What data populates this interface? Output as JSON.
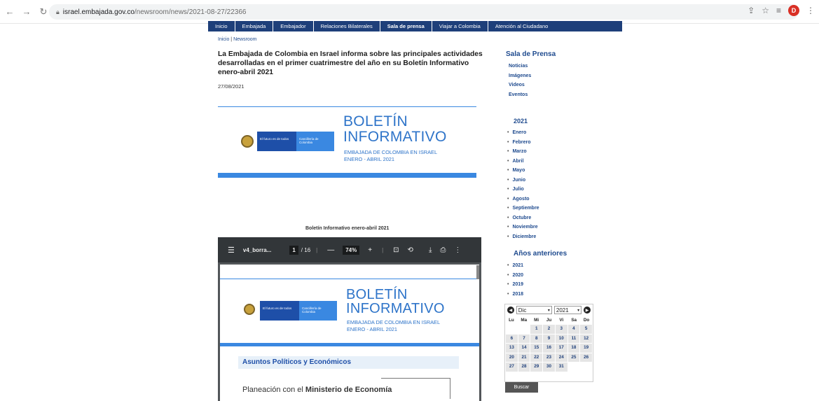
{
  "browser": {
    "url_host": "israel.embajada.gov.co",
    "url_path": "/newsroom/news/2021-08-27/22366",
    "avatar_letter": "D"
  },
  "nav": {
    "items": [
      "Inicio",
      "Embajada",
      "Embajador",
      "Relaciones Bilaterales",
      "Sala de prensa",
      "Viajar a Colombia",
      "Atención al Ciudadano"
    ],
    "active": "Sala de prensa"
  },
  "breadcrumb": {
    "home": "Inicio",
    "sep": " | ",
    "current": "Newsroom"
  },
  "article": {
    "title": "La Embajada de Colombia en Israel informa sobre las principales actividades desarrolladas en el primer cuatrimestre del año en su Boletín Informativo enero-abril 2021",
    "date": "27/08/2021",
    "pdf_caption": "Boletín Informativo enero-abril 2021"
  },
  "banner": {
    "logo_left": "El futuro es de todos",
    "logo_right": "Cancillería de Colombia",
    "title_line1": "BOLETÍN",
    "title_line2": "INFORMATIVO",
    "subtitle_line1": "EMBAJADA DE COLOMBIA EN ISRAEL",
    "subtitle_line2": "ENERO - ABRIL 2021"
  },
  "pdf": {
    "filename": "v4_borra...",
    "page_current": "1",
    "page_total": "/ 16",
    "zoom": "74%",
    "section_title": "Asuntos Políticos y Económicos",
    "subheading_prefix": "Planeación con el ",
    "subheading_bold": "Ministerio de Economía"
  },
  "sidebar": {
    "title": "Sala de Prensa",
    "links": [
      "Noticias",
      "Imágenes",
      "Videos",
      "Eventos"
    ],
    "year_title": "2021",
    "months": [
      "Enero",
      "Febrero",
      "Marzo",
      "Abril",
      "Mayo",
      "Junio",
      "Julio",
      "Agosto",
      "Septiembre",
      "Octubre",
      "Noviembre",
      "Diciembre"
    ],
    "prev_title": "Años anteriores",
    "years": [
      "2021",
      "2020",
      "2019",
      "2018"
    ]
  },
  "calendar": {
    "month": "Dic",
    "year": "2021",
    "weekdays": [
      "Lu",
      "Ma",
      "Mi",
      "Ju",
      "Vi",
      "Sa",
      "Do"
    ],
    "leading_blanks": 2,
    "days": 31,
    "button": "Buscar"
  }
}
